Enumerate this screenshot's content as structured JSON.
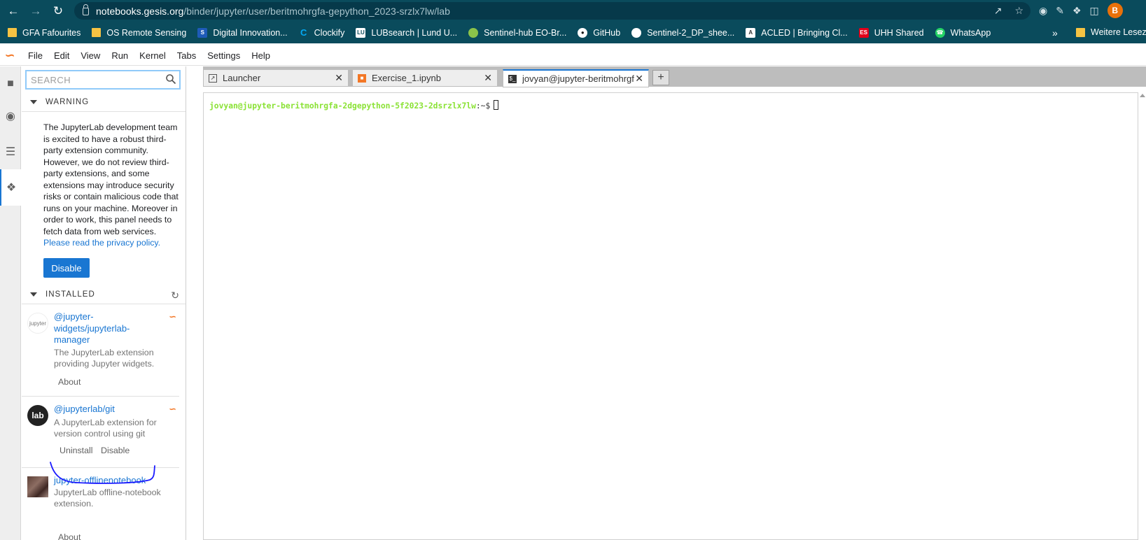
{
  "browser": {
    "url_host": "notebooks.gesis.org",
    "url_path": "/binder/jupyter/user/beritmohrgfa-gepython_2023-srzlx7lw/lab",
    "profile_initial": "B",
    "bookmarks": [
      {
        "label": "GFA Fafourites",
        "icon": "folder-icon"
      },
      {
        "label": "OS Remote Sensing",
        "icon": "folder-icon"
      },
      {
        "label": "Digital Innovation...",
        "icon": "site-icon"
      },
      {
        "label": "Clockify",
        "icon": "clockify-icon"
      },
      {
        "label": "LUBsearch | Lund U...",
        "icon": "lu-icon"
      },
      {
        "label": "Sentinel-hub EO-Br...",
        "icon": "globe-icon"
      },
      {
        "label": "GitHub",
        "icon": "github-icon"
      },
      {
        "label": "Sentinel-2_DP_shee...",
        "icon": "globe-icon"
      },
      {
        "label": "ACLED | Bringing Cl...",
        "icon": "acled-icon"
      },
      {
        "label": "UHH Shared",
        "icon": "uhh-icon"
      },
      {
        "label": "WhatsApp",
        "icon": "whatsapp-icon"
      }
    ],
    "bookmarks_more": "»",
    "other_bookmarks": "Weitere Leseze"
  },
  "menubar": {
    "items": [
      "File",
      "Edit",
      "View",
      "Run",
      "Kernel",
      "Tabs",
      "Settings",
      "Help"
    ]
  },
  "extensions": {
    "search_placeholder": "SEARCH",
    "warning": {
      "title": "WARNING",
      "text": "The JupyterLab development team is excited to have a robust third-party extension community. However, we do not review third-party extensions, and some extensions may introduce security risks or contain malicious code that runs on your machine. Moreover in order to work, this panel needs to fetch data from web services.",
      "link": "Please read the privacy policy.",
      "button": "Disable"
    },
    "installed": {
      "title": "INSTALLED",
      "items": [
        {
          "name": "@jupyter-widgets/jupyterlab-manager",
          "description": "The JupyterLab extension providing Jupyter widgets.",
          "actions": [
            "About"
          ],
          "logo": "jupyter"
        },
        {
          "name": "@jupyterlab/git",
          "description": "A JupyterLab extension for version control using git",
          "actions": [
            "Uninstall",
            "Disable"
          ],
          "logo": "lab"
        },
        {
          "name": "jupyter-offlinenotebook",
          "description": "JupyterLab offline-notebook extension.",
          "actions": [
            "About"
          ],
          "logo": "image"
        }
      ]
    }
  },
  "tabs": [
    {
      "label": "Launcher",
      "icon": "launcher-icon"
    },
    {
      "label": "Exercise_1.ipynb",
      "icon": "notebook-icon"
    },
    {
      "label": "jovyan@jupyter-beritmohrgf",
      "icon": "terminal-icon",
      "active": true
    }
  ],
  "terminal": {
    "prompt": "jovyan@jupyter-beritmohrgfa-2dgepython-5f2023-2dsrzlx7lw",
    "separator": ":~$"
  },
  "colors": {
    "chrome": "#0a4b5c",
    "accent": "#1976d2",
    "jupyter_orange": "#f37726",
    "prompt_green": "#8ae234",
    "annotation": "#1a1aff"
  }
}
